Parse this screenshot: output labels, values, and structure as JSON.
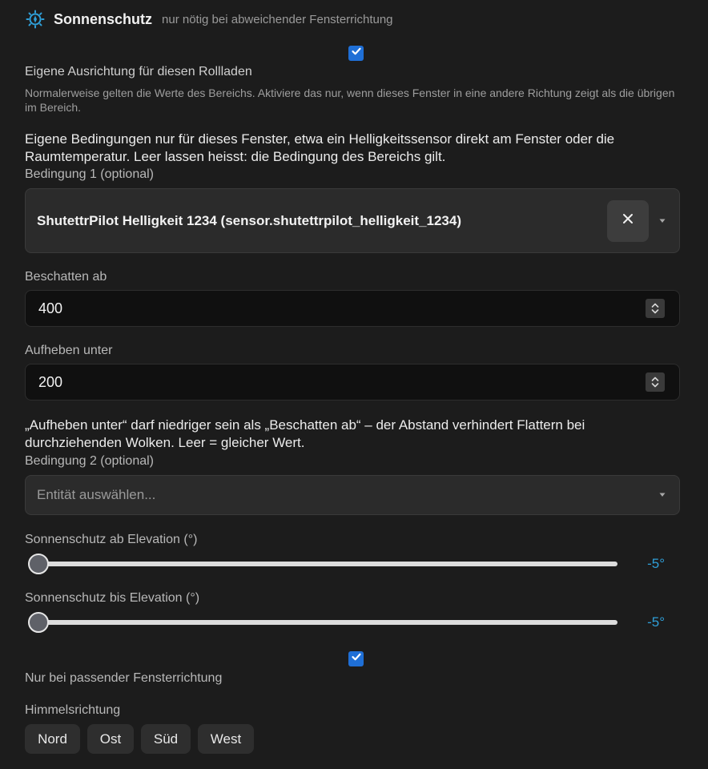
{
  "header": {
    "title": "Sonnenschutz",
    "subtitle": "nur nötig bei abweichender Fensterrichtung",
    "icon": "sun-compass-icon",
    "accent": "#2f9fd8"
  },
  "own_orientation": {
    "checked": true,
    "label": "Eigene Ausrichtung für diesen Rollladen",
    "helper": "Normalerweise gelten die Werte des Bereichs. Aktiviere das nur, wenn dieses Fenster in eine andere Richtung zeigt als die übrigen im Bereich."
  },
  "conditions_intro": "Eigene Bedingungen nur für dieses Fenster, etwa ein Helligkeitssensor direkt am Fenster oder die Raumtemperatur. Leer lassen heisst: die Bedingung des Bereichs gilt.",
  "condition1": {
    "label": "Bedingung 1 (optional)",
    "value": "ShutettrPilot Helligkeit 1234 (sensor.shutettrpilot_helligkeit_1234)"
  },
  "shade_from": {
    "label": "Beschatten ab",
    "value": "400"
  },
  "release_below": {
    "label": "Aufheben unter",
    "value": "200"
  },
  "hysteresis_note": "„Aufheben unter“ darf niedriger sein als „Beschatten ab“ – der Abstand verhindert Flattern bei durchziehenden Wolken. Leer = gleicher Wert.",
  "condition2": {
    "label": "Bedingung 2 (optional)",
    "placeholder": "Entität auswählen..."
  },
  "elevation_from": {
    "label": "Sonnenschutz ab Elevation (°)",
    "value_text": "-5°",
    "fraction": 0.0
  },
  "elevation_to": {
    "label": "Sonnenschutz bis Elevation (°)",
    "value_text": "-5°",
    "fraction": 0.0
  },
  "matching_direction": {
    "checked": true,
    "label": "Nur bei passender Fensterrichtung"
  },
  "directions": {
    "label": "Himmelsrichtung",
    "options": [
      "Nord",
      "Ost",
      "Süd",
      "West"
    ]
  },
  "colors": {
    "background": "#1c1c1c",
    "checkbox": "#1f6fd6",
    "slider_value": "#2f9fd8"
  }
}
